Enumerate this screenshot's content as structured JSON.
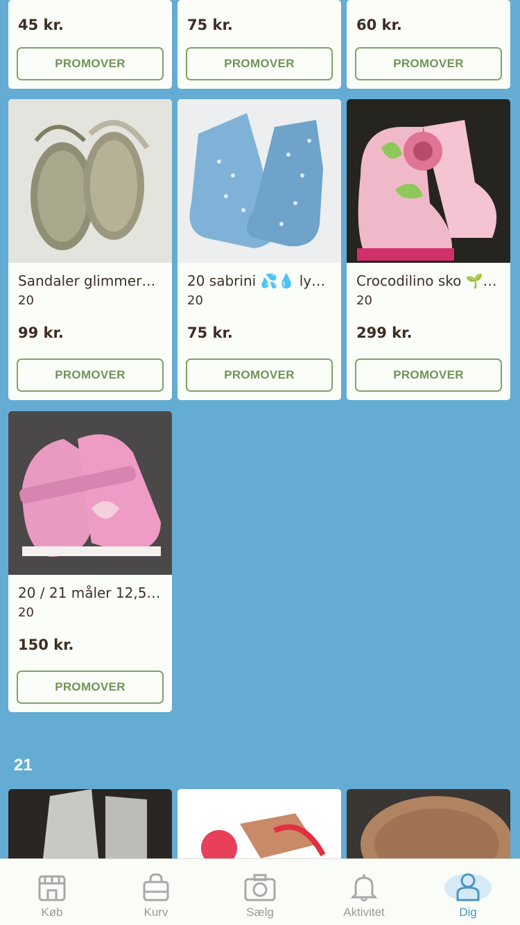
{
  "top_row": [
    {
      "price": "45 kr.",
      "promo": "PROMOVER"
    },
    {
      "price": "75 kr.",
      "promo": "PROMOVER"
    },
    {
      "price": "60 kr.",
      "promo": "PROMOVER"
    }
  ],
  "listings": [
    {
      "title": "Sandaler  glimmer…",
      "size": "20",
      "price": "99 kr.",
      "promo": "PROMOVER",
      "image": "glitter-sandals-image"
    },
    {
      "title": "20  sabrini 💦💧 ly…",
      "size": "20",
      "price": "75 kr.",
      "promo": "PROMOVER",
      "image": "blue-rain-boots-image"
    },
    {
      "title": "Crocodilino sko 🌱…",
      "size": "20",
      "price": "299 kr.",
      "promo": "PROMOVER",
      "image": "pink-flower-boots-image"
    },
    {
      "title": "20 / 21 måler 12,5…",
      "size": "20",
      "price": "150 kr.",
      "promo": "PROMOVER",
      "image": "pink-shoes-image"
    }
  ],
  "section": {
    "label": "21"
  },
  "tabs": [
    {
      "label": "Køb",
      "icon": "shop-icon"
    },
    {
      "label": "Kurv",
      "icon": "bag-icon"
    },
    {
      "label": "Sælg",
      "icon": "camera-icon"
    },
    {
      "label": "Aktivitet",
      "icon": "bell-icon"
    },
    {
      "label": "Dig",
      "icon": "person-icon",
      "active": true
    }
  ],
  "colors": {
    "background": "#64acd4",
    "card": "#fbfdf8",
    "accent_green": "#6e9558",
    "tab_active": "#4a95c4"
  }
}
